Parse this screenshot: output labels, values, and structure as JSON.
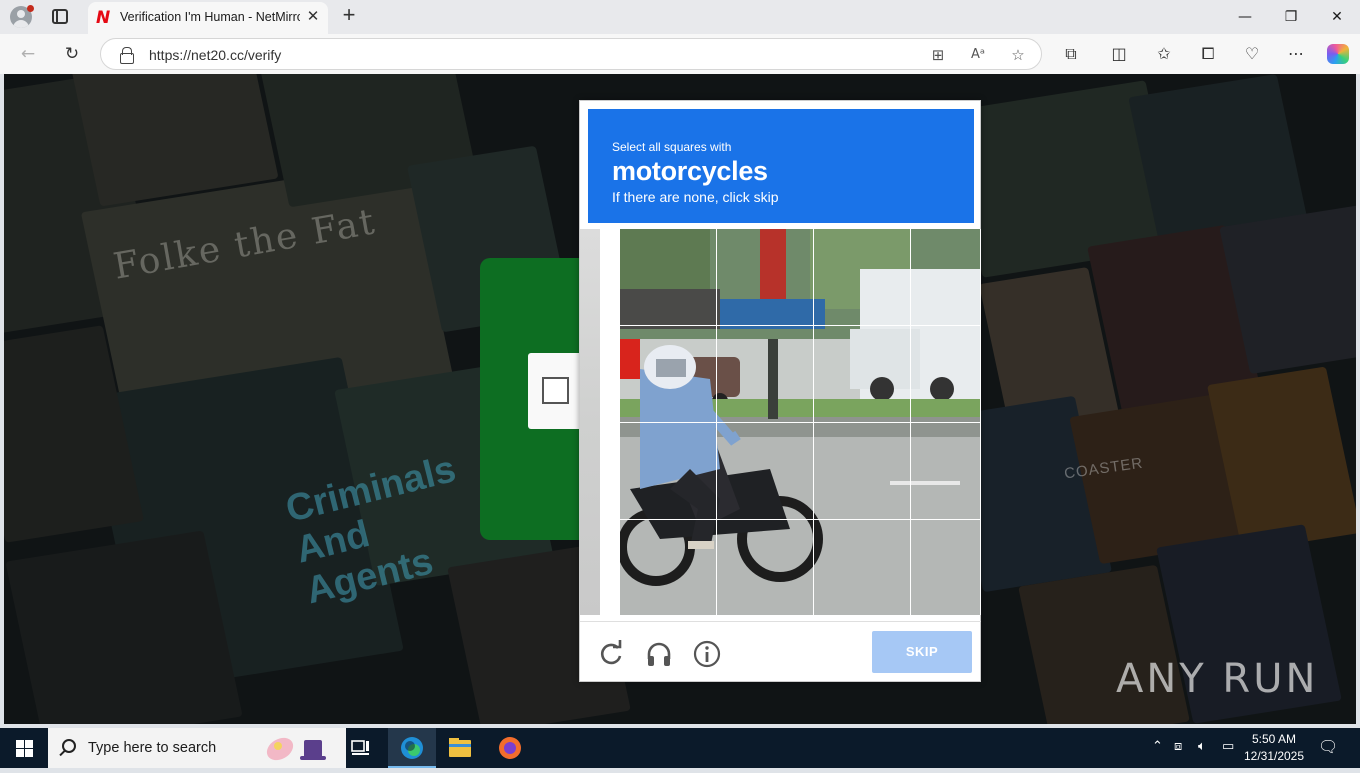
{
  "browser": {
    "tab_title": "Verification I'm Human - NetMirror",
    "tab_favicon": "N",
    "url": "https://net20.cc/verify"
  },
  "background_text": {
    "poster1": "Folke the Fat",
    "poster2": "Criminals And Agents",
    "poster3": "COASTER"
  },
  "captcha": {
    "instruction": "Select all squares with",
    "target": "motorcycles",
    "hint": "If there are none, click skip",
    "skip_label": "SKIP",
    "selected_tiles": []
  },
  "watermark": "ANY RUN",
  "taskbar": {
    "search_placeholder": "Type here to search",
    "time": "5:50 AM",
    "date": "12/31/2025"
  },
  "colors": {
    "captcha_header": "#1a73e8",
    "skip_button": "#a6c8f5",
    "green_card": "#0d6e22"
  }
}
